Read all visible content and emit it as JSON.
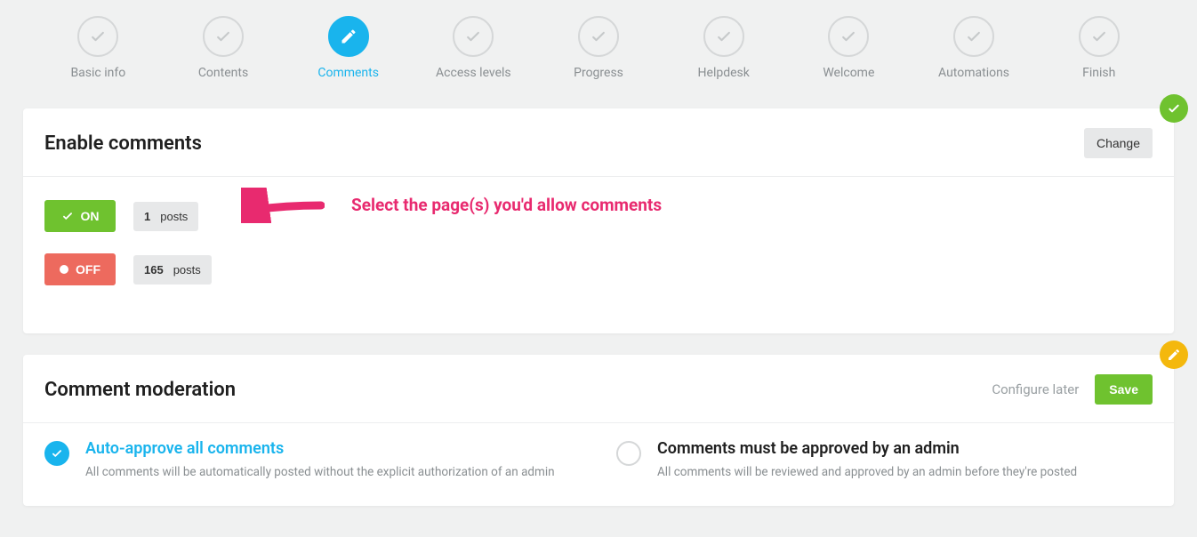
{
  "stepper": {
    "items": [
      {
        "label": "Basic info"
      },
      {
        "label": "Contents"
      },
      {
        "label": "Comments"
      },
      {
        "label": "Access levels"
      },
      {
        "label": "Progress"
      },
      {
        "label": "Helpdesk"
      },
      {
        "label": "Welcome"
      },
      {
        "label": "Automations"
      },
      {
        "label": "Finish"
      }
    ],
    "active_index": 2
  },
  "enable_comments": {
    "title": "Enable comments",
    "change_label": "Change",
    "on_label": "ON",
    "off_label": "OFF",
    "on_count": "1",
    "on_unit": "posts",
    "off_count": "165",
    "off_unit": "posts"
  },
  "annotation": {
    "text": "Select the page(s) you'd allow comments"
  },
  "moderation": {
    "title": "Comment moderation",
    "configure_later_label": "Configure later",
    "save_label": "Save",
    "options": [
      {
        "title": "Auto-approve all comments",
        "desc": "All comments will be automatically posted without the explicit authorization of an admin",
        "selected": true
      },
      {
        "title": "Comments must be approved by an admin",
        "desc": "All comments will be reviewed and approved by an admin before they're posted",
        "selected": false
      }
    ]
  }
}
